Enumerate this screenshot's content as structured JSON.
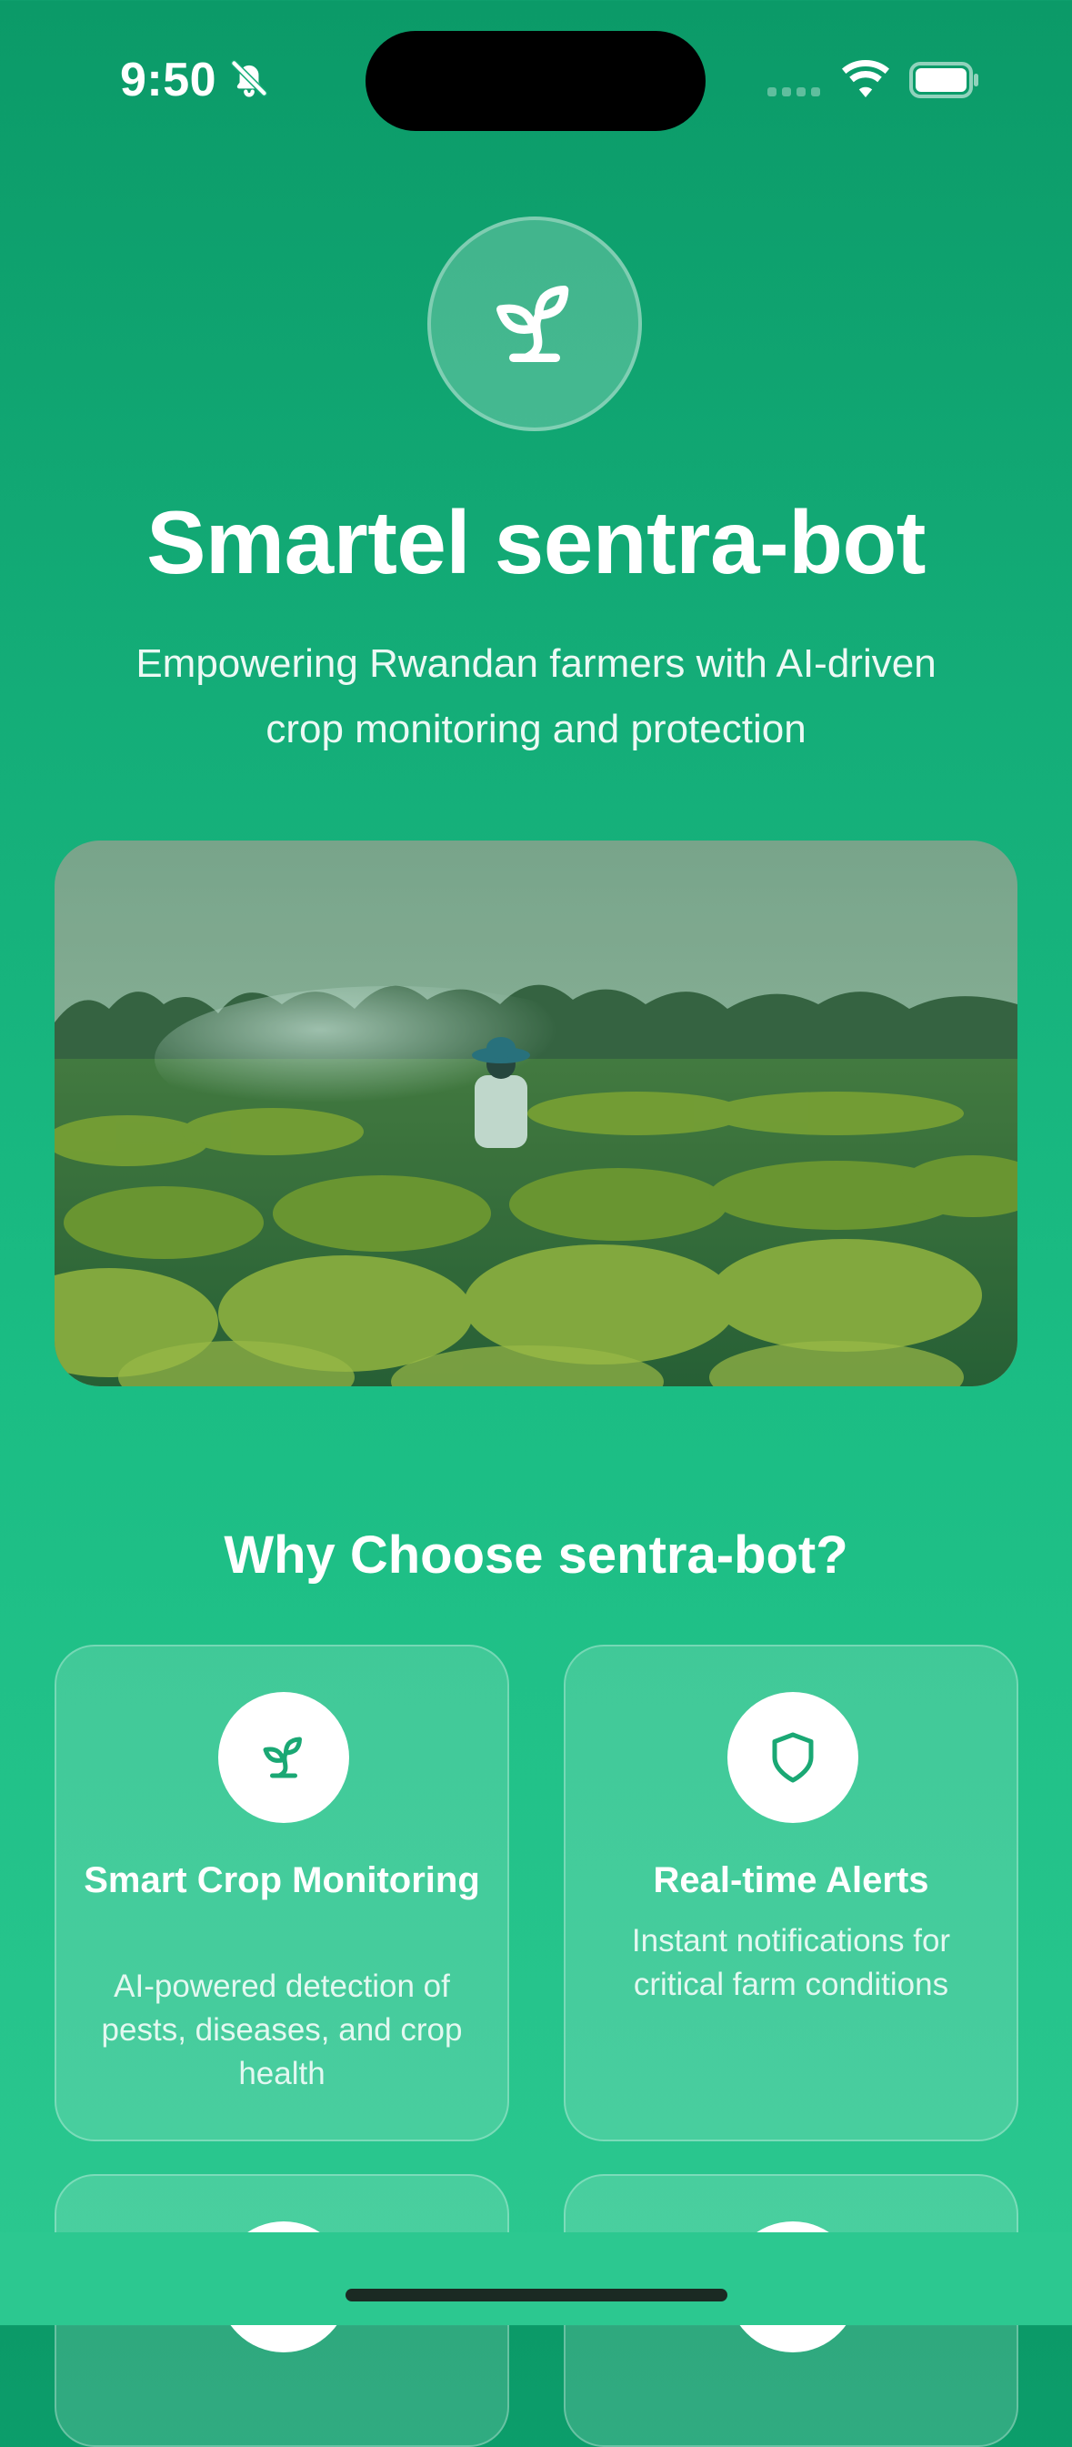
{
  "status_bar": {
    "time": "9:50",
    "icons": [
      "bell-slash-icon",
      "cellular-signal-icon",
      "wifi-icon",
      "battery-icon"
    ]
  },
  "hero": {
    "logo_icon": "sprout-icon",
    "title": "Smartel sentra-bot",
    "subtitle": "Empowering Rwandan farmers with AI-driven crop monitoring and protection",
    "image_description_icon": "farm-field-image"
  },
  "features": {
    "heading": "Why Choose sentra-bot?",
    "items": [
      {
        "icon": "sprout-icon",
        "title": "Smart Crop Monitoring",
        "description": "AI-powered detection of pests, diseases, and crop health"
      },
      {
        "icon": "shield-icon",
        "title": "Real-time Alerts",
        "description": "Instant notifications for critical farm conditions"
      }
    ]
  },
  "colors": {
    "primary_green": "#14ad78",
    "dark_green": "#0b9a68",
    "icon_green": "#1aa874"
  }
}
